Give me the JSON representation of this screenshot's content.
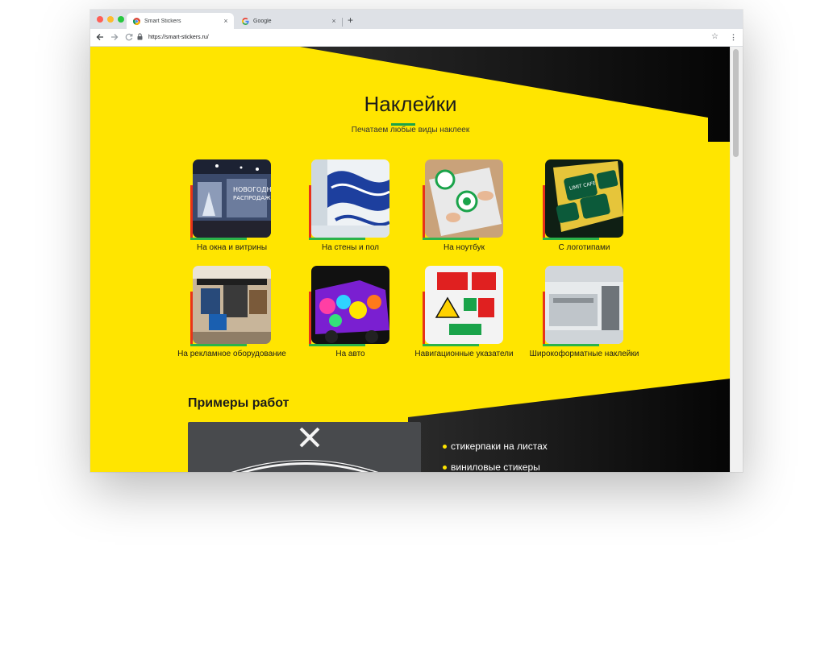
{
  "browser": {
    "tabs": [
      {
        "title": "Smart Stickers",
        "icon": "chrome-icon",
        "active": true
      },
      {
        "title": "Google",
        "icon": "google-icon",
        "active": false
      }
    ],
    "new_tab_label": "+",
    "close_label": "×",
    "url": "https://smart-stickers.ru/",
    "star_label": "☆",
    "menu_label": "⋮"
  },
  "hero": {
    "title": "Наклейки",
    "subtitle": "Печатаем любые виды наклеек"
  },
  "categories": [
    {
      "label": "На окна и витрины",
      "theme": "window-display"
    },
    {
      "label": "На стены и пол",
      "theme": "wall-floor"
    },
    {
      "label": "На ноутбук",
      "theme": "laptop"
    },
    {
      "label": "С логотипами",
      "theme": "logo"
    },
    {
      "label": "На рекламное оборудование",
      "theme": "exhibition"
    },
    {
      "label": "На авто",
      "theme": "car"
    },
    {
      "label": "Навигационные указатели",
      "theme": "signs"
    },
    {
      "label": "Широкоформатные наклейки",
      "theme": "wide-format"
    }
  ],
  "works": {
    "title": "Примеры работ",
    "bullets": [
      "стикерпаки на листах",
      "виниловые стикеры"
    ]
  },
  "colors": {
    "brand_yellow": "#ffe500",
    "dark": "#0d0d0d",
    "accent_green": "#2bb34a",
    "accent_red": "#e8321a"
  }
}
